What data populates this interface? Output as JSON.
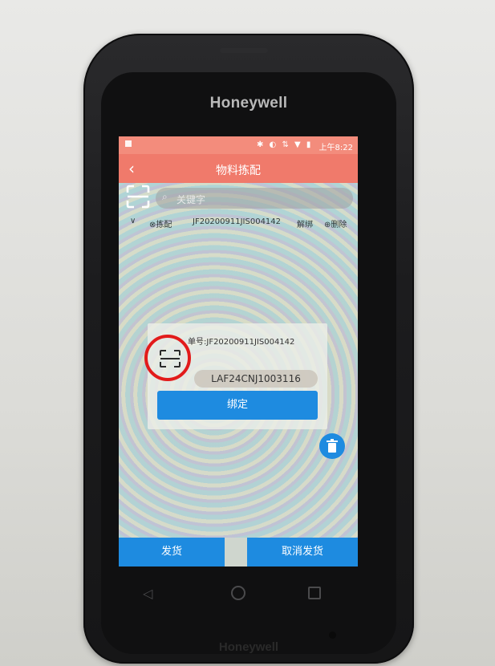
{
  "device": {
    "brand_top": "Honeywell",
    "brand_bottom": "Honeywell"
  },
  "status_bar": {
    "time": "上午8:22",
    "icons": "✱ ◐ ⇅ ▼ ▮"
  },
  "header": {
    "back_icon": "‹",
    "title": "物料拣配"
  },
  "search": {
    "placeholder": "关键字",
    "icon": "search-icon"
  },
  "list": {
    "rows": [
      {
        "expand_icon": "∨",
        "tag": "⊗拣配",
        "code": "JF20200911JIS004142",
        "unbind_label": "解绑",
        "delete_label": "⊕删除"
      }
    ]
  },
  "dialog": {
    "order_label": "单号:JF20200911JIS004142",
    "input_value": "LAF24CNJ1003116",
    "bind_label": "绑定"
  },
  "footer": {
    "ship_label": "发货",
    "cancel_ship_label": "取消发货"
  },
  "nav": {
    "back": "◁",
    "home": "○",
    "recent": "□"
  },
  "colors": {
    "header_coral": "#f07a6b",
    "primary_blue": "#1e8be0",
    "highlight_red": "#e21b1b"
  }
}
